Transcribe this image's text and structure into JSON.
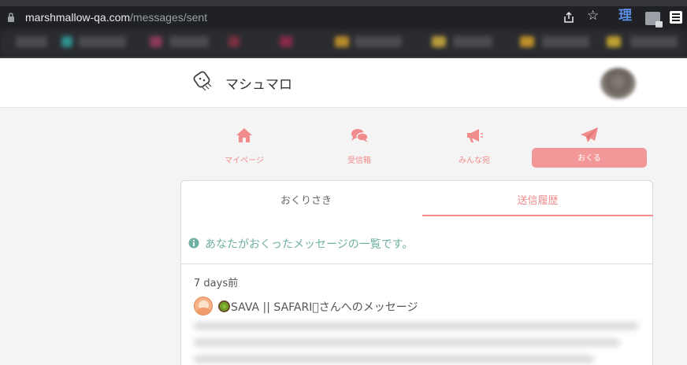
{
  "browser": {
    "url_host": "marshmallow-qa.com",
    "url_path": "/messages/sent",
    "extension_label": "理"
  },
  "header": {
    "brand": "マシュマロ"
  },
  "nav": {
    "items": [
      {
        "label": "マイページ",
        "icon": "home-icon"
      },
      {
        "label": "受信箱",
        "icon": "chat-bubbles-icon"
      },
      {
        "label": "みんな宛",
        "icon": "megaphone-icon"
      },
      {
        "label": "おくる",
        "icon": "paper-plane-icon"
      }
    ],
    "active_index": 3
  },
  "tabs": {
    "items": [
      "おくりさき",
      "送信履歴"
    ],
    "active_index": 1
  },
  "info": {
    "text": "あなたがおくったメッセージの一覧です。"
  },
  "message": {
    "time": "7 days前",
    "recipient": "SAVA || SAFARI\u0000さんへのメッセージ"
  },
  "colors": {
    "accent": "#f29898",
    "info": "#6fb0a2"
  }
}
